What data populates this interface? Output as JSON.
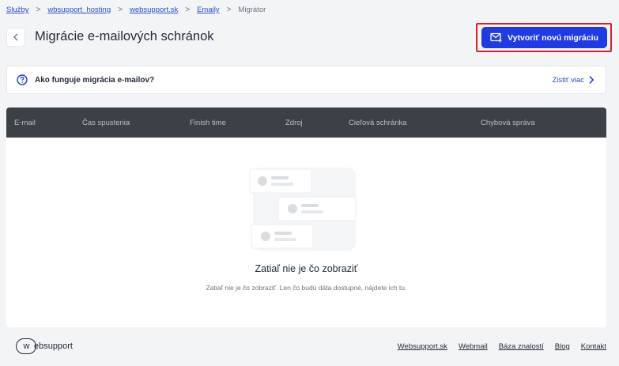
{
  "breadcrumb": {
    "items": [
      "Služby",
      "wbsupport_hosting",
      "websupport.sk",
      "Emaily"
    ],
    "current": "Migrátor"
  },
  "header": {
    "title": "Migrácie e-mailových schránok",
    "cta_label": "Vytvoriť novú migráciu"
  },
  "info_bar": {
    "title": "Ako funguje migrácia e-mailov?",
    "link_label": "Zistiť viac"
  },
  "table": {
    "columns": [
      "E-mail",
      "Čas spustenia",
      "Finish time",
      "Zdroj",
      "Cieľová schránka",
      "Chybová správa"
    ]
  },
  "empty_state": {
    "title": "Zatiaľ nie je čo zobraziť",
    "subtitle": "Zatiaľ nie je čo zobraziť. Len čo budú dáta dostupné, nájdete ich tu."
  },
  "footer": {
    "logo_text": "ebsupport",
    "logo_mark": "w",
    "links": [
      "Websupport.sk",
      "Webmail",
      "Báza znalostí",
      "Blog",
      "Kontakt"
    ]
  },
  "colors": {
    "primary": "#1f3be6",
    "link": "#2b4bd8",
    "table_header": "#3c4147",
    "highlight": "#e11d26"
  }
}
